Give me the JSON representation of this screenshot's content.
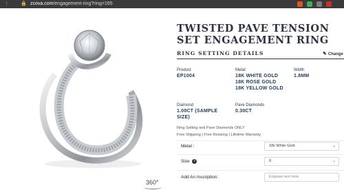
{
  "browser": {
    "url_host": "zcova.com",
    "url_path": "/engagement-ring?ring=165",
    "lock_icon": "lock-icon",
    "extension_icons": [
      "brave-icon",
      "extension-icon",
      "extension-icon",
      "extension-icon"
    ]
  },
  "product": {
    "title": "TWISTED PAVE TENSION SET ENGAGEMENT RING",
    "section_title": "RING SETTING DETAILS",
    "change_label": "Change",
    "change_icon": "pencil-icon",
    "specs": {
      "product_label": "Product",
      "product_value": "EP1004",
      "metal_label": "Metal",
      "metal_values": [
        "18K WHITE GOLD",
        "18K ROSE GOLD",
        "18K YELLOW GOLD"
      ],
      "width_label": "Width",
      "width_value": "1.8MM",
      "diamond_label": "Diamond",
      "diamond_value": "1.00CT (SAMPLE SIZE)",
      "pave_label": "Pave Diamonds",
      "pave_value": "0.30CT"
    },
    "note_1": "Ring Setting and Pave Diamonds ONLY",
    "note_2": "Free Shipping | Free Resizing | Lifetime Warranty"
  },
  "options": {
    "metal_label": "Metal :",
    "metal_selected": "18k White Gold",
    "size_label": "Size",
    "size_icon": "info-icon",
    "size_selected": "8",
    "inscription_label": "Add An Inscription:",
    "inscription_placeholder": "Engrave text here"
  },
  "viewer": {
    "spin_label": "360°",
    "spin_icon": "rotate-360-icon"
  }
}
